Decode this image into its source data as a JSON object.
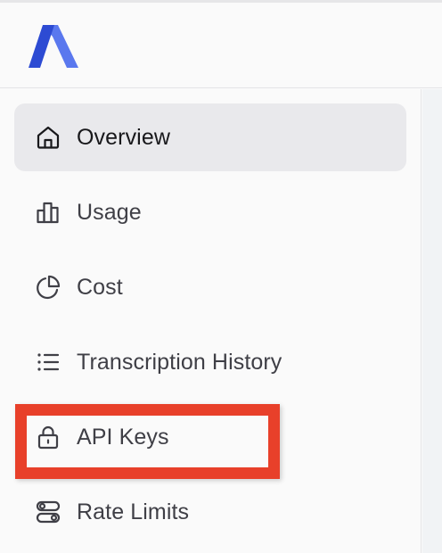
{
  "brand": {
    "logo_icon": "brand-logo-icon",
    "accent": "#3b5bdb"
  },
  "sidebar": {
    "items": [
      {
        "label": "Overview",
        "icon": "home-icon",
        "active": true
      },
      {
        "label": "Usage",
        "icon": "bar-chart-icon",
        "active": false
      },
      {
        "label": "Cost",
        "icon": "pie-chart-icon",
        "active": false
      },
      {
        "label": "Transcription History",
        "icon": "list-icon",
        "active": false
      },
      {
        "label": "API Keys",
        "icon": "lock-icon",
        "active": false,
        "highlighted": true
      },
      {
        "label": "Rate Limits",
        "icon": "toggles-icon",
        "active": false
      }
    ]
  },
  "colors": {
    "highlight": "#e8402a",
    "active_bg": "#e9e9ec"
  }
}
